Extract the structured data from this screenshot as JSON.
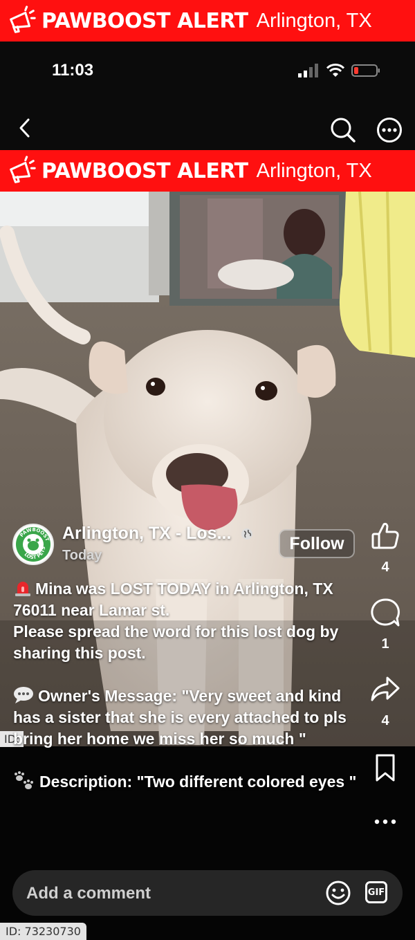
{
  "banner": {
    "brand": "PAWBOOST ALERT",
    "city": "Arlington, TX"
  },
  "status": {
    "time": "11:03",
    "battery_color": "#ff3b30"
  },
  "nav": {
    "back_icon": "chevron-left-icon",
    "search_icon": "search-icon",
    "more_icon": "more-icon"
  },
  "post": {
    "account_name": "Arlington, TX - Los...",
    "account_sub": "Today",
    "avatar_text": "PAWBOOST LOST PETS",
    "follow_label": "Follow",
    "caption": {
      "line1": "Mina was LOST TODAY in Arlington, TX 76011 near Lamar st.",
      "line2": "Please spread the word for this lost dog by sharing this post.",
      "line3": "Owner's Message: \"Very sweet and kind has a sister that she is every attached to pls bring her home we miss her so much \"",
      "line4": "Description: \"Two different colored eyes \""
    }
  },
  "actions": {
    "likes": "4",
    "comments": "1",
    "shares": "4"
  },
  "comment_box": {
    "placeholder": "Add a comment",
    "gif_label": "GIF"
  },
  "id_tags": {
    "mid": "ID:",
    "bottom": "ID: 73230730"
  },
  "colors": {
    "brand_red": "#ff1010",
    "avatar_green": "#3aa64a"
  }
}
